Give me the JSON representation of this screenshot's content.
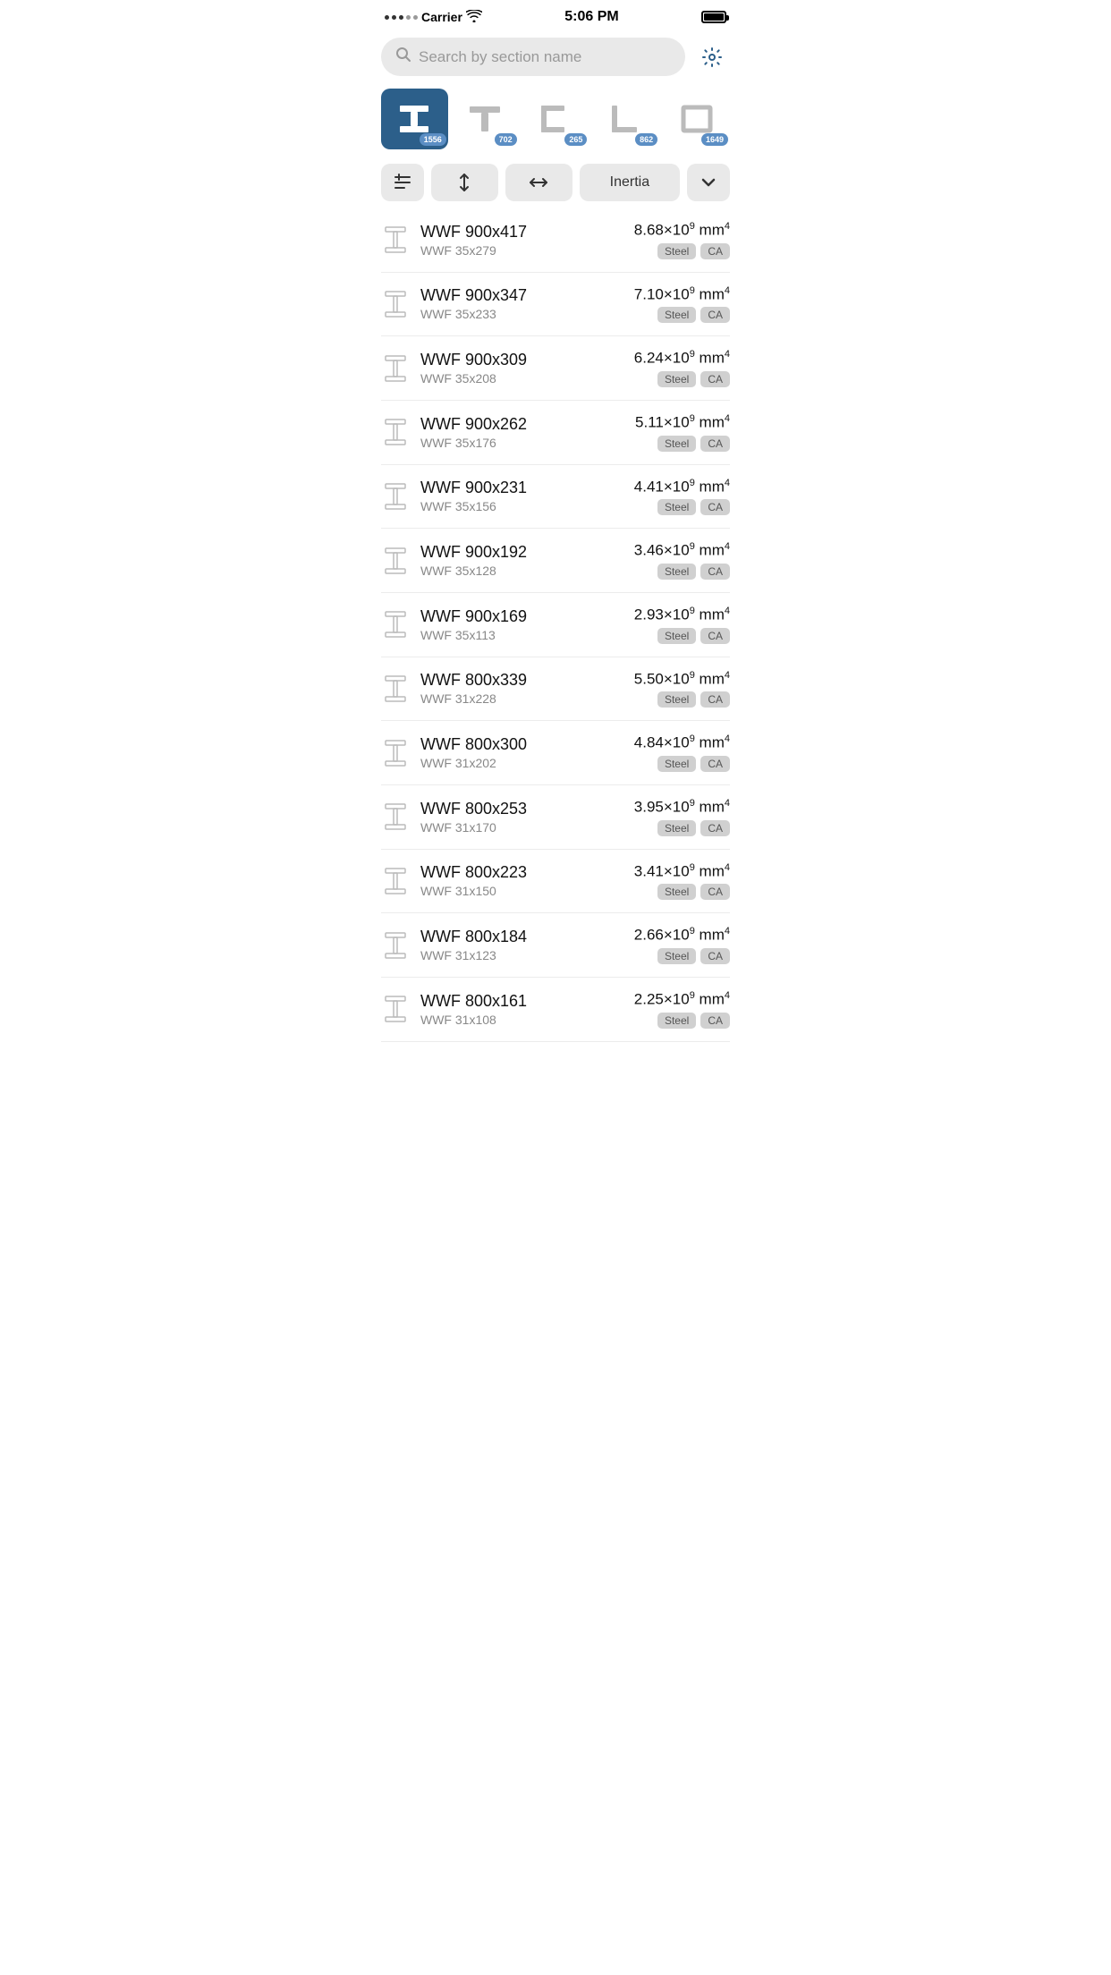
{
  "statusBar": {
    "carrier": "Carrier",
    "time": "5:06 PM"
  },
  "search": {
    "placeholder": "Search by section name"
  },
  "shapeTabs": [
    {
      "id": "ibeam",
      "label": "I-beam",
      "count": "1556",
      "active": true
    },
    {
      "id": "tee",
      "label": "Tee",
      "count": "702",
      "active": false
    },
    {
      "id": "channel",
      "label": "Channel",
      "count": "265",
      "active": false
    },
    {
      "id": "angle",
      "label": "Angle",
      "count": "862",
      "active": false
    },
    {
      "id": "rect",
      "label": "Rectangle",
      "count": "1649",
      "active": false
    }
  ],
  "sortToolbar": {
    "filterIcon": "↑≡",
    "heightLabel": "↕",
    "widthLabel": "↔",
    "propertyLabel": "Inertia",
    "sortDirLabel": "∨"
  },
  "sections": [
    {
      "name": "WWF 900x417",
      "sub": "WWF 35x279",
      "value": "8.68×10",
      "exp": "9",
      "unit": "mm",
      "unitExp": "4",
      "tags": [
        "Steel",
        "CA"
      ]
    },
    {
      "name": "WWF 900x347",
      "sub": "WWF 35x233",
      "value": "7.10×10",
      "exp": "9",
      "unit": "mm",
      "unitExp": "4",
      "tags": [
        "Steel",
        "CA"
      ]
    },
    {
      "name": "WWF 900x309",
      "sub": "WWF 35x208",
      "value": "6.24×10",
      "exp": "9",
      "unit": "mm",
      "unitExp": "4",
      "tags": [
        "Steel",
        "CA"
      ]
    },
    {
      "name": "WWF 900x262",
      "sub": "WWF 35x176",
      "value": "5.11×10",
      "exp": "9",
      "unit": "mm",
      "unitExp": "4",
      "tags": [
        "Steel",
        "CA"
      ]
    },
    {
      "name": "WWF 900x231",
      "sub": "WWF 35x156",
      "value": "4.41×10",
      "exp": "9",
      "unit": "mm",
      "unitExp": "4",
      "tags": [
        "Steel",
        "CA"
      ]
    },
    {
      "name": "WWF 900x192",
      "sub": "WWF 35x128",
      "value": "3.46×10",
      "exp": "9",
      "unit": "mm",
      "unitExp": "4",
      "tags": [
        "Steel",
        "CA"
      ]
    },
    {
      "name": "WWF 900x169",
      "sub": "WWF 35x113",
      "value": "2.93×10",
      "exp": "9",
      "unit": "mm",
      "unitExp": "4",
      "tags": [
        "Steel",
        "CA"
      ]
    },
    {
      "name": "WWF 800x339",
      "sub": "WWF 31x228",
      "value": "5.50×10",
      "exp": "9",
      "unit": "mm",
      "unitExp": "4",
      "tags": [
        "Steel",
        "CA"
      ]
    },
    {
      "name": "WWF 800x300",
      "sub": "WWF 31x202",
      "value": "4.84×10",
      "exp": "9",
      "unit": "mm",
      "unitExp": "4",
      "tags": [
        "Steel",
        "CA"
      ]
    },
    {
      "name": "WWF 800x253",
      "sub": "WWF 31x170",
      "value": "3.95×10",
      "exp": "9",
      "unit": "mm",
      "unitExp": "4",
      "tags": [
        "Steel",
        "CA"
      ]
    },
    {
      "name": "WWF 800x223",
      "sub": "WWF 31x150",
      "value": "3.41×10",
      "exp": "9",
      "unit": "mm",
      "unitExp": "4",
      "tags": [
        "Steel",
        "CA"
      ]
    },
    {
      "name": "WWF 800x184",
      "sub": "WWF 31x123",
      "value": "2.66×10",
      "exp": "9",
      "unit": "mm",
      "unitExp": "4",
      "tags": [
        "Steel",
        "CA"
      ]
    },
    {
      "name": "WWF 800x161",
      "sub": "WWF 31x108",
      "value": "2.25×10",
      "exp": "9",
      "unit": "mm",
      "unitExp": "4",
      "tags": [
        "Steel",
        "CA"
      ]
    }
  ]
}
